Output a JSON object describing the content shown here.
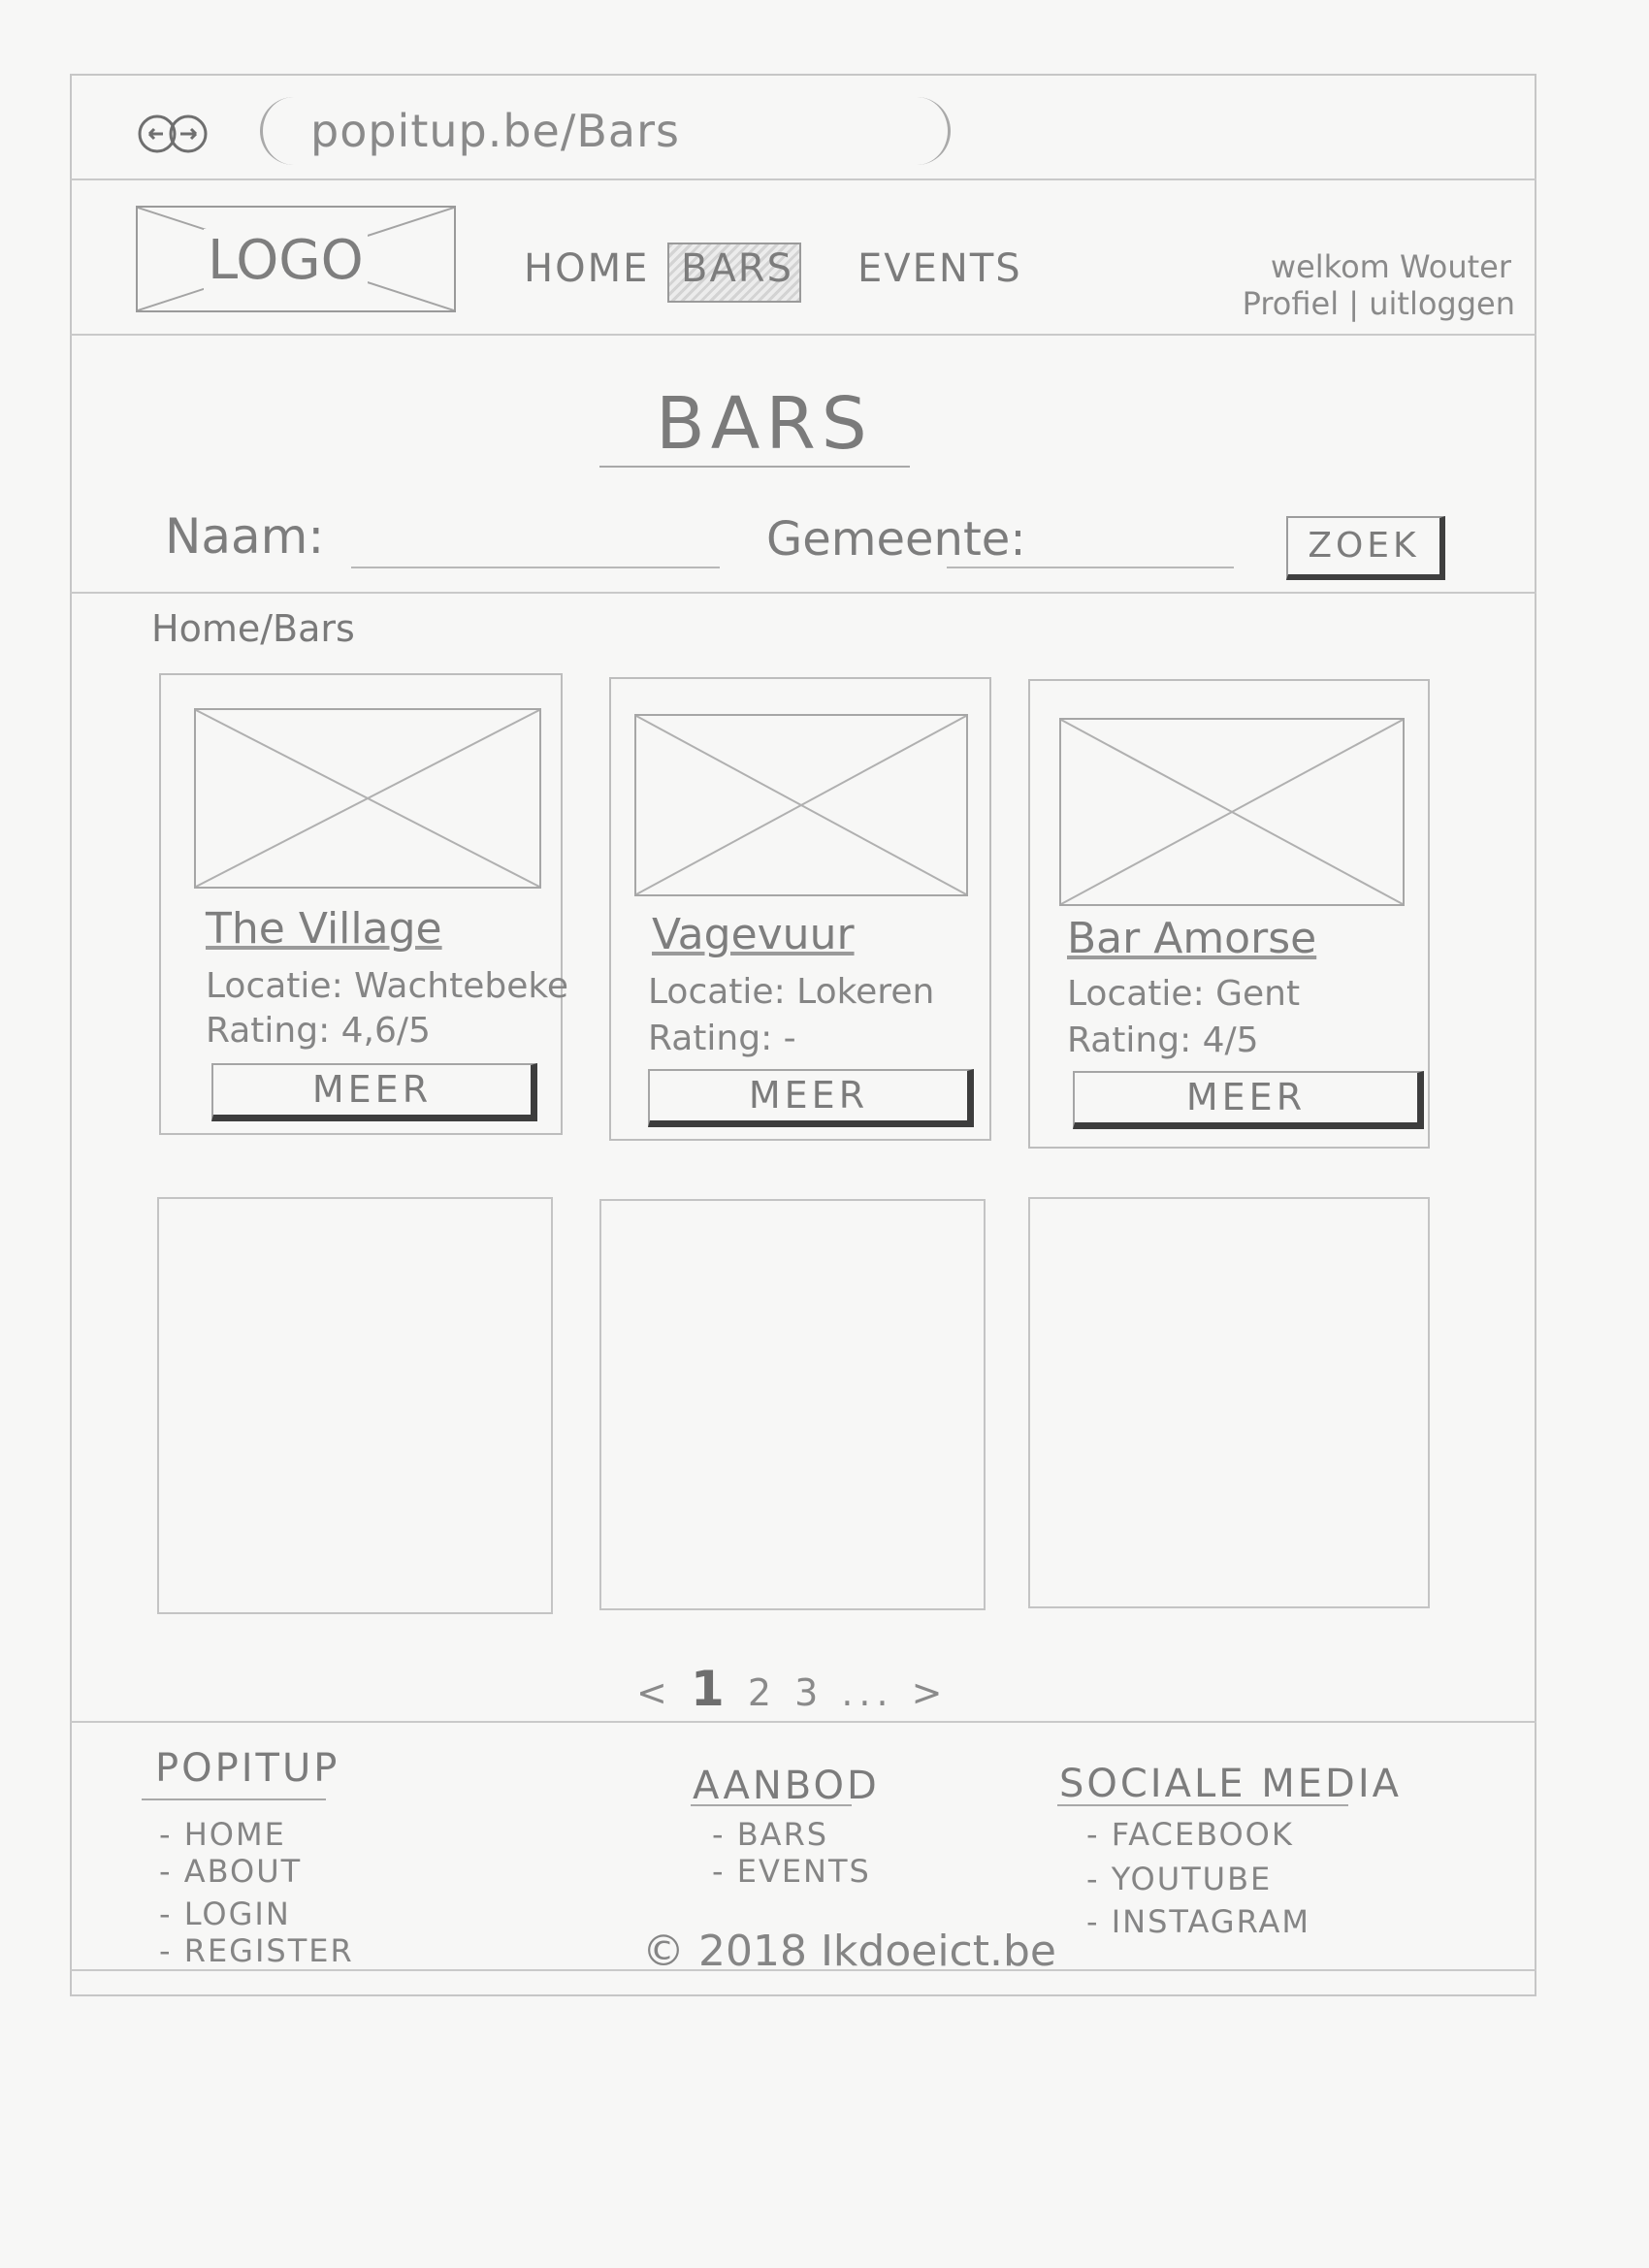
{
  "browser": {
    "url": "popitup.be/Bars"
  },
  "header": {
    "logo": "LOGO",
    "nav": [
      {
        "label": "HOME",
        "active": false
      },
      {
        "label": "BARS",
        "active": true
      },
      {
        "label": "EVENTS",
        "active": false
      }
    ],
    "user": {
      "welcome": "welkom Wouter",
      "links": "Profiel | uitloggen"
    }
  },
  "search": {
    "title": "BARS",
    "name_label": "Naam:",
    "municipality_label": "Gemeente:",
    "button": "ZOEK"
  },
  "breadcrumb": "Home/Bars",
  "cards": [
    {
      "name": "The Village",
      "location": "Locatie: Wachtebeke",
      "rating": "Rating: 4,6/5",
      "button": "MEER"
    },
    {
      "name": "Vagevuur",
      "location": "Locatie: Lokeren",
      "rating": "Rating: -",
      "button": "MEER"
    },
    {
      "name": "Bar Amorse",
      "location": "Locatie: Gent",
      "rating": "Rating: 4/5",
      "button": "MEER"
    }
  ],
  "pagination": {
    "prev": "<",
    "current": "1",
    "pages": "2 3 ...",
    "next": ">"
  },
  "footer": {
    "columns": [
      {
        "title": "POPITUP",
        "links": [
          "- HOME",
          "- ABOUT",
          "- LOGIN",
          "- REGISTER"
        ]
      },
      {
        "title": "AANBOD",
        "links": [
          "- BARS",
          "- EVENTS"
        ]
      },
      {
        "title": "SOCIALE MEDIA",
        "links": [
          "- FACEBOOK",
          "- YOUTUBE",
          "- INSTAGRAM"
        ]
      }
    ],
    "copyright": "© 2018 Ikdoeict.be"
  }
}
